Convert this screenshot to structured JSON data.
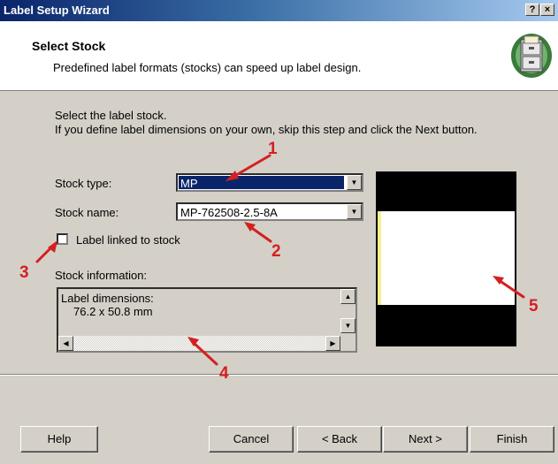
{
  "window": {
    "title": "Label Setup Wizard",
    "help_btn": "?",
    "close_btn": "×"
  },
  "header": {
    "title": "Select Stock",
    "subtitle": "Predefined label formats (stocks) can speed up label design.",
    "icon": "filing-cabinet-icon"
  },
  "instructions": {
    "line1": "Select the label stock.",
    "line2": "If you define label dimensions on your own, skip this step and click the Next button."
  },
  "stock_type": {
    "label": "Stock type:",
    "value": "MP"
  },
  "stock_name": {
    "label": "Stock name:",
    "value": "MP-762508-2.5-8A"
  },
  "linked": {
    "label": "Label linked to stock",
    "checked": false
  },
  "stock_info": {
    "label": "Stock information:",
    "line1": "Label dimensions:",
    "line2": "76.2 x 50.8 mm"
  },
  "annotations": [
    "1",
    "2",
    "3",
    "4",
    "5"
  ],
  "buttons": {
    "help": "Help",
    "cancel": "Cancel",
    "back": "< Back",
    "next": "Next >",
    "finish": "Finish"
  },
  "colors": {
    "annotation": "#d32020",
    "selection": "#0a246a",
    "title_bar": "#0a246a"
  }
}
